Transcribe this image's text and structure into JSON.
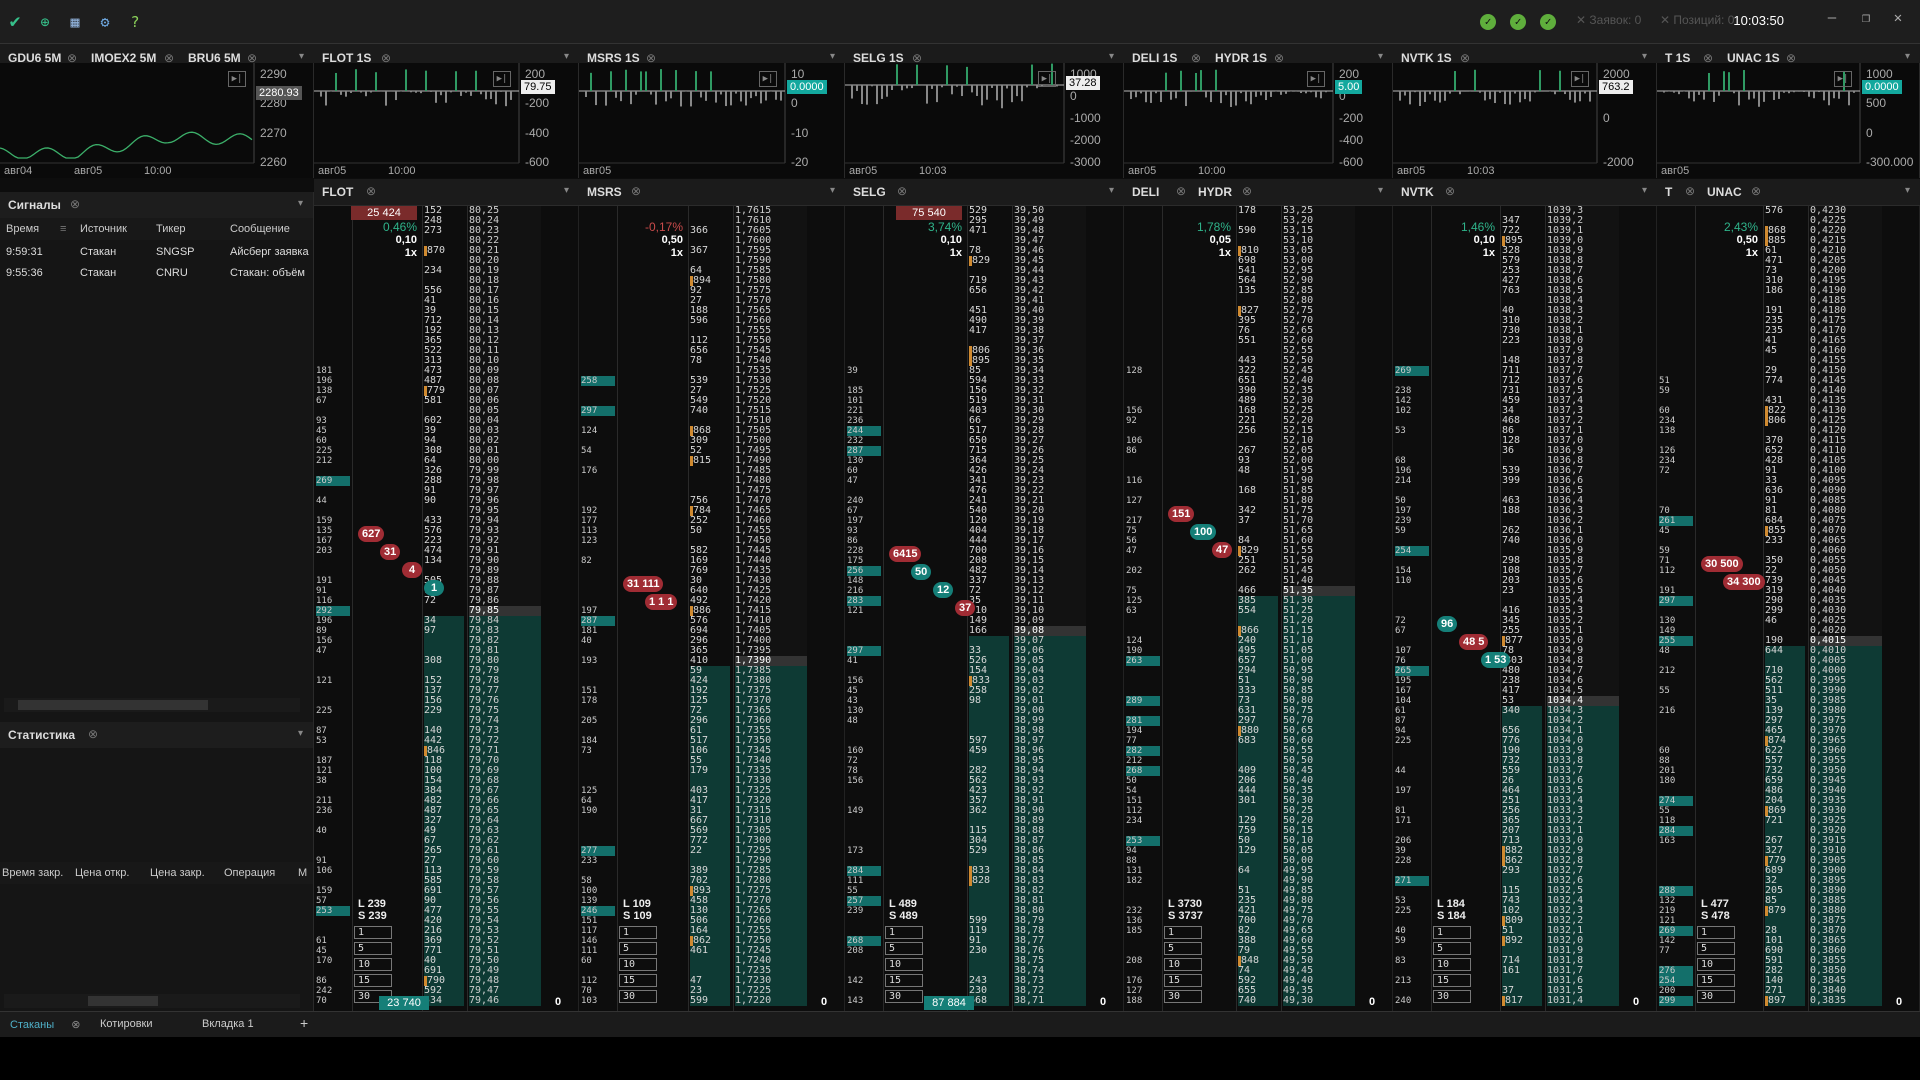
{
  "topbar": {
    "clock": "10:03:50",
    "orders": "Заявок: 0",
    "positions": "Позиций: 0"
  },
  "charts": [
    {
      "tabs": [
        "GDU6 5M",
        "IMOEX2 5M",
        "BRU6 5M"
      ],
      "y": [
        "2290",
        "2280",
        "2270",
        "2260"
      ],
      "badge": "2280.93",
      "x": [
        "авг04",
        "авг05",
        "10:00"
      ]
    },
    {
      "tabs": [
        "FLOT 1S"
      ],
      "y": [
        "200",
        "-200",
        "-400",
        "-600"
      ],
      "badge": "79.75",
      "x": [
        "авг05",
        "10:00"
      ]
    },
    {
      "tabs": [
        "MSRS 1S"
      ],
      "y": [
        "10",
        "0",
        "-10",
        "-20"
      ],
      "badge": "0.0000",
      "x": [
        "авг05"
      ]
    },
    {
      "tabs": [
        "SELG 1S"
      ],
      "y": [
        "1000",
        "0",
        "-1000",
        "-2000",
        "-3000"
      ],
      "badge": "37.28",
      "x": [
        "авг05",
        "10:03"
      ]
    },
    {
      "tabs": [
        "DELI 1S",
        "HYDR 1S"
      ],
      "y": [
        "200",
        "0",
        "-200",
        "-400",
        "-600"
      ],
      "badge": "5.00",
      "x": [
        "авг05",
        "10:00"
      ]
    },
    {
      "tabs": [
        "NVTK 1S"
      ],
      "y": [
        "2000",
        "0",
        "-2000"
      ],
      "badge": "763.2",
      "x": [
        "авг05",
        "10:03"
      ]
    },
    {
      "tabs": [
        "T 1S",
        "UNAC 1S"
      ],
      "y": [
        "1000",
        "500",
        "0",
        "-300.000"
      ],
      "badge": "0.0000",
      "x": [
        "авг05"
      ]
    }
  ],
  "signals": {
    "title": "Сигналы",
    "cols": [
      "Время",
      "Источник",
      "Тикер",
      "Сообщение"
    ],
    "rows": [
      [
        "9:59:31",
        "Стакан",
        "SNGSP",
        "Айсберг заявка"
      ],
      [
        "9:55:36",
        "Стакан",
        "CNRU",
        "Стакан: объём"
      ]
    ]
  },
  "stats": {
    "title": "Статистика",
    "cols": [
      "Время закр.",
      "Цена откр.",
      "Цена закр.",
      "Операция",
      "М"
    ]
  },
  "doms": [
    {
      "name": "FLOT",
      "pct": "0,46%",
      "pct2": "25 424",
      "vol": "0,10",
      "mult": "1x",
      "L": "L 239",
      "S": "S 239",
      "bottom": "23 740",
      "zero": "0",
      "p0": 80.25,
      "step": 0.01,
      "dec": 2,
      "midrow": 40,
      "trades": [
        {
          "t": "627",
          "c": "sell"
        },
        {
          "t": "31",
          "c": "sell"
        },
        {
          "t": "4",
          "c": "sell"
        },
        {
          "t": "1",
          "c": "buy"
        }
      ]
    },
    {
      "name": "MSRS",
      "pct": "-0,17%",
      "vol": "0,50",
      "mult": "1x",
      "L": "L 109",
      "S": "S 109",
      "bottom": "",
      "zero": "0",
      "p0": 1.7615,
      "step": 0.0005,
      "dec": 4,
      "midrow": 45,
      "trades": [
        {
          "t": "31 111",
          "c": "sell"
        },
        {
          "t": "1 1 1",
          "c": "sell"
        }
      ]
    },
    {
      "name": "SELG",
      "pct": "3,74%",
      "pct2": "75 540",
      "vol": "0,10",
      "mult": "1x",
      "L": "L 489",
      "S": "S 489",
      "bottom": "87 884",
      "zero": "0",
      "p0": 39.5,
      "step": 0.01,
      "dec": 2,
      "midrow": 42,
      "trades": [
        {
          "t": "6415",
          "c": "sell"
        },
        {
          "t": "50",
          "c": "buy"
        },
        {
          "t": "12",
          "c": "buy"
        },
        {
          "t": "37",
          "c": "sell"
        }
      ]
    },
    {
      "name": "DELI",
      "name2": "HYDR",
      "pct": "1,78%",
      "vol": "0,05",
      "mult": "1x",
      "L": "L 3730",
      "S": "S 3737",
      "bottom": "",
      "zero": "0",
      "p0": 53.25,
      "step": 0.05,
      "dec": 2,
      "midrow": 38,
      "trades": [
        {
          "t": "151",
          "c": "sell"
        },
        {
          "t": "100",
          "c": "buy"
        },
        {
          "t": "47",
          "c": "sell"
        }
      ]
    },
    {
      "name": "NVTK",
      "pct": "1,46%",
      "vol": "0,10",
      "mult": "1x",
      "L": "L 184",
      "S": "S 184",
      "bottom": "",
      "zero": "0",
      "p0": 1039.3,
      "step": 0.1,
      "dec": 1,
      "midrow": 49,
      "trades": [
        {
          "t": "96",
          "c": "buy"
        },
        {
          "t": "48 5",
          "c": "sell"
        },
        {
          "t": "1 53",
          "c": "buy"
        }
      ]
    },
    {
      "name": "T",
      "name2": "UNAC",
      "pct": "2,43%",
      "vol": "0,50",
      "mult": "1x",
      "L": "L 477",
      "S": "S 478",
      "bottom": "",
      "zero": "0",
      "p0": 0.423,
      "step": 0.0005,
      "dec": 4,
      "midrow": 43,
      "trades": [
        {
          "t": "30 500",
          "c": "sell"
        },
        {
          "t": "34 300",
          "c": "sell"
        }
      ]
    }
  ],
  "bottomtabs": [
    "Стаканы",
    "Котировки",
    "Вкладка 1",
    "+"
  ]
}
